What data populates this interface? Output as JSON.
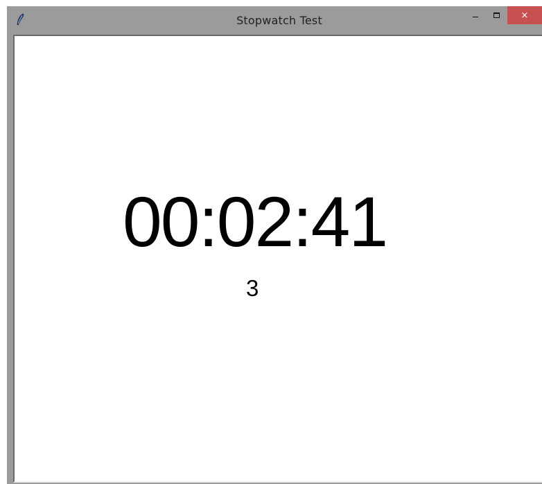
{
  "window": {
    "title": "Stopwatch Test",
    "icon": "feather-icon",
    "controls": {
      "minimize": "minimize-icon",
      "maximize": "maximize-icon",
      "close_label": "×"
    },
    "colors": {
      "frame": "#9b9b9b",
      "close_button": "#c75050",
      "client_background": "#ffffff",
      "text": "#000000"
    }
  },
  "stopwatch": {
    "elapsed_time": "00:02:41",
    "count": "3"
  }
}
